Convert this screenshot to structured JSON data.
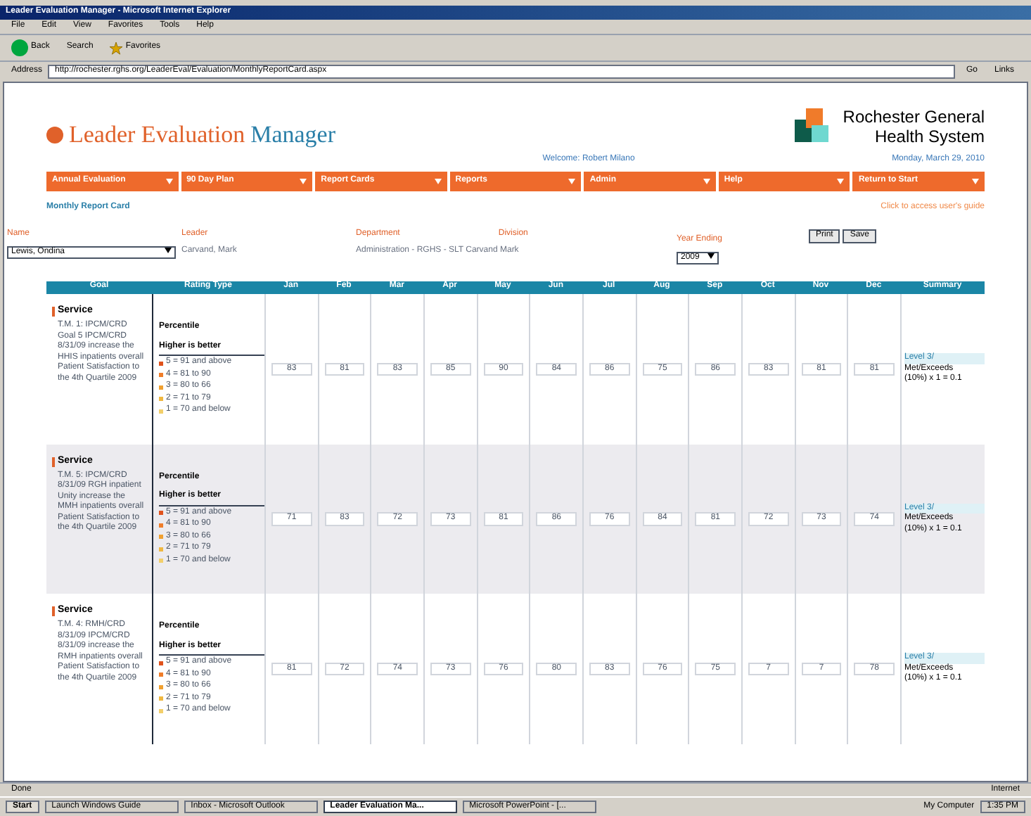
{
  "window": {
    "title": "Leader Evaluation Manager - Microsoft Internet Explorer"
  },
  "menu": [
    "File",
    "Edit",
    "View",
    "Favorites",
    "Tools",
    "Help"
  ],
  "toolbar": {
    "back": "Back",
    "search": "Search",
    "favorites": "Favorites"
  },
  "address": {
    "label": "Address",
    "value": "http://rochester.rghs.org/LeaderEval/Evaluation/MonthlyReportCard.aspx",
    "go": "Go",
    "links": "Links"
  },
  "header": {
    "app_title": "Leader Evaluation",
    "app_title_accent": "Manager",
    "org_line_1": "Rochester General",
    "org_line_2": "Health System",
    "welcome": "Welcome: Robert Milano",
    "date": "Monday, March 29, 2010"
  },
  "nav": [
    "Annual Evaluation",
    "90 Day Plan",
    "Report Cards",
    "Reports",
    "Admin",
    "Help",
    "Return to Start"
  ],
  "page_title": "Monthly Report Card",
  "guide_link": "Click to access user's guide",
  "filters": {
    "name_label": "Name",
    "name_value": "Lewis, Ondina",
    "leader_label": "Leader",
    "leader_value": "Carvand, Mark",
    "department_label": "Department",
    "department_value": "Administration - RGHS - SLT Carvand Mark",
    "division_label": "Division",
    "year_label": "Year Ending",
    "year_value": "2009",
    "buttons": [
      "Print",
      "Save"
    ]
  },
  "table": {
    "columns": [
      "Goal",
      "Rating Type",
      "Jan",
      "Feb",
      "Mar",
      "Apr",
      "May",
      "Jun",
      "Jul",
      "Aug",
      "Sep",
      "Oct",
      "Nov",
      "Dec",
      "Summary"
    ],
    "rows": [
      {
        "goal": "Service",
        "description": "T.M. 1: IPCM/CRD Goal 5 IPCM/CRD 8/31/09 increase the HHIS inpatients overall Patient Satisfaction to the 4th Quartile 2009",
        "rating": "Percentile",
        "direction": "Higher is better",
        "legend": [
          {
            "text": "5 = 91 and above",
            "color": "#e0521c"
          },
          {
            "text": "4 = 81 to 90",
            "color": "#ef7d2a"
          },
          {
            "text": "3 = 80 to 66",
            "color": "#f0a030"
          },
          {
            "text": "2 = 71 to 79",
            "color": "#f0b840"
          },
          {
            "text": "1 = 70 and below",
            "color": "#f3cf6a"
          }
        ],
        "values": [
          "83",
          "81",
          "83",
          "85",
          "90",
          "84",
          "86",
          "75",
          "86",
          "83",
          "81",
          "81"
        ],
        "summary_level": "Level 3/",
        "summary_status": "Met/Exceeds",
        "summary_calc": "(10%) x 1 = 0.1"
      },
      {
        "goal": "Service",
        "description": "T.M. 5: IPCM/CRD 8/31/09 RGH inpatient Unity increase the MMH inpatients overall Patient Satisfaction to the 4th Quartile 2009",
        "rating": "Percentile",
        "direction": "Higher is better",
        "legend": [
          {
            "text": "5 = 91 and above",
            "color": "#e0521c"
          },
          {
            "text": "4 = 81 to 90",
            "color": "#ef7d2a"
          },
          {
            "text": "3 = 80 to 66",
            "color": "#f0a030"
          },
          {
            "text": "2 = 71 to 79",
            "color": "#f0b840"
          },
          {
            "text": "1 = 70 and below",
            "color": "#f3cf6a"
          }
        ],
        "values": [
          "71",
          "83",
          "72",
          "73",
          "81",
          "86",
          "76",
          "84",
          "81",
          "72",
          "73",
          "74"
        ],
        "summary_level": "Level 3/",
        "summary_status": "Met/Exceeds",
        "summary_calc": "(10%) x 1 = 0.1"
      },
      {
        "goal": "Service",
        "description": "T.M. 4: RMH/CRD 8/31/09 IPCM/CRD 8/31/09 increase the RMH inpatients overall Patient Satisfaction to the 4th Quartile 2009",
        "rating": "Percentile",
        "direction": "Higher is better",
        "legend": [
          {
            "text": "5 = 91 and above",
            "color": "#e0521c"
          },
          {
            "text": "4 = 81 to 90",
            "color": "#ef7d2a"
          },
          {
            "text": "3 = 80 to 66",
            "color": "#f0a030"
          },
          {
            "text": "2 = 71 to 79",
            "color": "#f0b840"
          },
          {
            "text": "1 = 70 and below",
            "color": "#f3cf6a"
          }
        ],
        "values": [
          "81",
          "72",
          "74",
          "73",
          "76",
          "80",
          "83",
          "76",
          "75",
          "7",
          "7",
          "78"
        ],
        "summary_level": "Level 3/",
        "summary_status": "Met/Exceeds",
        "summary_calc": "(10%) x 1 = 0.1"
      }
    ]
  },
  "status_bar": {
    "text": "Done",
    "zone": "Internet"
  },
  "taskbar": {
    "start": "Start",
    "items": [
      {
        "label": "Launch Windows Guide",
        "selected": false
      },
      {
        "label": "Inbox - Microsoft Outlook",
        "selected": false
      },
      {
        "label": "Leader Evaluation Ma...",
        "selected": true
      },
      {
        "label": "Microsoft PowerPoint - [...",
        "selected": false
      }
    ],
    "tray": "My Computer",
    "clock": "1:35 PM"
  }
}
